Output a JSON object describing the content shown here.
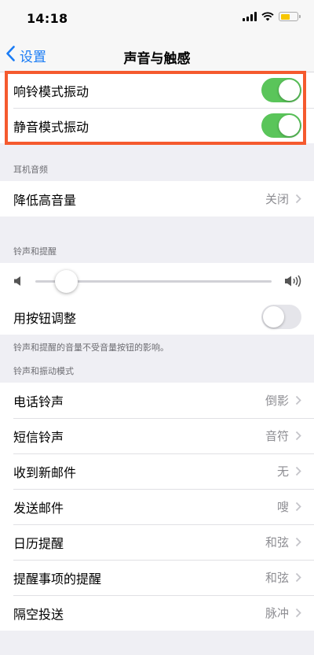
{
  "status_bar": {
    "time": "14:18"
  },
  "nav": {
    "back_label": "设置",
    "title": "声音与触感"
  },
  "vibration": [
    {
      "label": "响铃模式振动",
      "on": true
    },
    {
      "label": "静音模式振动",
      "on": true
    }
  ],
  "headphone": {
    "header": "耳机音频",
    "item": {
      "label": "降低高音量",
      "value": "关闭"
    }
  },
  "ringer": {
    "header": "铃声和提醒",
    "volume": 0.13,
    "button_adjust": {
      "label": "用按钮调整",
      "on": false
    },
    "footer": "铃声和提醒的音量不受音量按钮的影响。"
  },
  "patterns": {
    "header": "铃声和振动模式",
    "items": [
      {
        "label": "电话铃声",
        "value": "倒影"
      },
      {
        "label": "短信铃声",
        "value": "音符"
      },
      {
        "label": "收到新邮件",
        "value": "无"
      },
      {
        "label": "发送邮件",
        "value": "嗖"
      },
      {
        "label": "日历提醒",
        "value": "和弦"
      },
      {
        "label": "提醒事项的提醒",
        "value": "和弦"
      },
      {
        "label": "隔空投送",
        "value": "脉冲"
      }
    ]
  },
  "colors": {
    "accent": "#1a7cf5",
    "toggle_on": "#5ac55a",
    "highlight": "#f55a2e"
  }
}
